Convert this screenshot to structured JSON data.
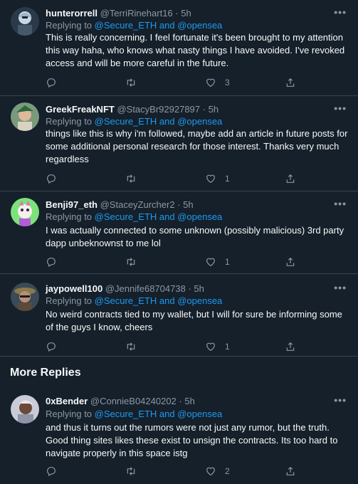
{
  "tweets": [
    {
      "name": "hunterorrell",
      "handle": "@TerriRinehart16",
      "sep": "·",
      "time": "5h",
      "reply_prefix": "Replying to",
      "reply_mentions": "@Secure_ETH and @opensea",
      "text": "This is really concerning. I feel fortunate it's been brought to my attention this way haha, who knows what nasty things I have avoided. I've revoked access and will be more careful in the future.",
      "likes": "3",
      "avatar_color": "#2b3a4a"
    },
    {
      "name": "GreekFreakNFT",
      "handle": "@StacyBr92927897",
      "sep": "·",
      "time": "5h",
      "reply_prefix": "Replying to",
      "reply_mentions": "@Secure_ETH and @opensea",
      "text": "things like this is why i'm followed, maybe add an article in future posts for some additional personal research for those interest. Thanks very much regardless",
      "likes": "1",
      "avatar_color": "#7a9a7c"
    },
    {
      "name": "Benji97_eth",
      "handle": "@StaceyZurcher2",
      "sep": "·",
      "time": "5h",
      "reply_prefix": "Replying to",
      "reply_mentions": "@Secure_ETH and @opensea",
      "text": "I was actually connected to some unknown (possibly malicious) 3rd party dapp unbeknownst to me lol",
      "likes": "1",
      "avatar_color": "#7de27a"
    },
    {
      "name": "jaypowell100",
      "handle": "@Jennife68704738",
      "sep": "·",
      "time": "5h",
      "reply_prefix": "Replying to",
      "reply_mentions": "@Secure_ETH and @opensea",
      "text": "No weird contracts tied to my wallet, but I will for sure be informing some of the guys I know, cheers",
      "likes": "1",
      "avatar_color": "#3a4a57"
    },
    {
      "name": "0xBender",
      "handle": "@ConnieB04240202",
      "sep": "·",
      "time": "5h",
      "reply_prefix": "Replying to",
      "reply_mentions": "@Secure_ETH and @opensea",
      "text": "and thus it turns out the rumors were not just any rumor, but the truth. Good thing sites likes these exist to unsign the contracts. Its too hard to navigate properly in this space istg",
      "likes": "2",
      "avatar_color": "#c9ccd6"
    }
  ],
  "more_replies_label": "More Replies",
  "more_icon": "•••"
}
